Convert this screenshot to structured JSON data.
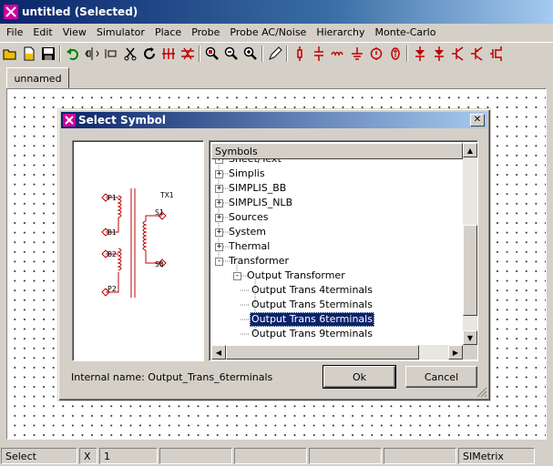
{
  "window": {
    "title": "untitled (Selected)"
  },
  "menu": [
    "File",
    "Edit",
    "View",
    "Simulator",
    "Place",
    "Probe",
    "Probe AC/Noise",
    "Hierarchy",
    "Monte-Carlo"
  ],
  "tab": {
    "label": "unnamed"
  },
  "dialog": {
    "title": "Select Symbol",
    "tree_header": "Symbols",
    "internal_name": "Internal name: Output_Trans_6terminals",
    "ok_label": "Ok",
    "cancel_label": "Cancel",
    "tree": [
      {
        "label": "Sheet/Text",
        "level": 0,
        "expander": "+"
      },
      {
        "label": "Simplis",
        "level": 0,
        "expander": "+"
      },
      {
        "label": "SIMPLIS_BB",
        "level": 0,
        "expander": "+"
      },
      {
        "label": "SIMPLIS_NLB",
        "level": 0,
        "expander": "+"
      },
      {
        "label": "Sources",
        "level": 0,
        "expander": "+"
      },
      {
        "label": "System",
        "level": 0,
        "expander": "+"
      },
      {
        "label": "Thermal",
        "level": 0,
        "expander": "+"
      },
      {
        "label": "Transformer",
        "level": 0,
        "expander": "-"
      },
      {
        "label": "Output Transformer",
        "level": 1,
        "expander": "-"
      },
      {
        "label": "Output Trans 4terminals",
        "level": 2
      },
      {
        "label": "Output Trans 5terminals",
        "level": 2
      },
      {
        "label": "Output Trans 6terminals",
        "level": 2,
        "selected": true
      },
      {
        "label": "Output Trans 9terminals",
        "level": 2
      }
    ],
    "preview": {
      "ref": "TX1",
      "pins": [
        "P1",
        "B1",
        "B2",
        "P2",
        "S1",
        "S0"
      ]
    }
  },
  "status": {
    "mode": "Select",
    "x_label": "X",
    "x_value": "1",
    "app": "SIMetrix"
  },
  "colors": {
    "title_start": "#0a246a",
    "title_end": "#a6caf0",
    "selection": "#0a246a",
    "symbol": "#c00000"
  },
  "toolbar_icons": [
    "open-folder-icon",
    "new-file-icon",
    "save-icon",
    "undo-icon",
    "mirror-icon",
    "rotate-icon",
    "cut-icon",
    "refresh-icon",
    "delete-wire-icon",
    "delete-icon",
    "zoom-area-icon",
    "zoom-out-icon",
    "zoom-in-icon",
    "pencil-icon",
    "resistor-icon",
    "capacitor-icon",
    "inductor-icon",
    "ground-icon",
    "voltage-source-icon",
    "current-source-icon",
    "diode-icon",
    "diode-icon",
    "npn-icon",
    "pnp-icon",
    "nmos-icon"
  ]
}
